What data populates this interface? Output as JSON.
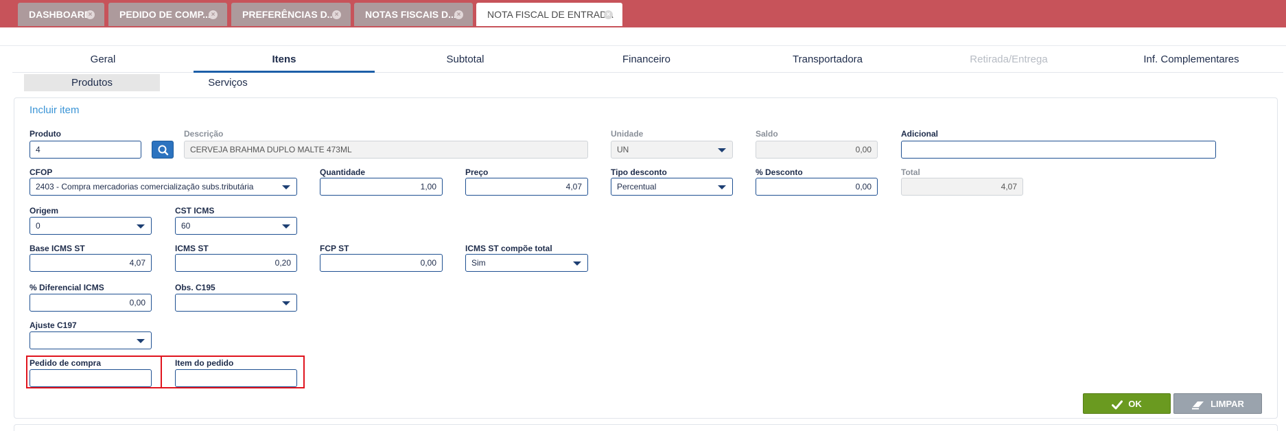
{
  "tabs": [
    {
      "label": "DASHBOARD"
    },
    {
      "label": "PEDIDO DE COMP..."
    },
    {
      "label": "PREFERÊNCIAS D..."
    },
    {
      "label": "NOTAS FISCAIS D..."
    },
    {
      "label": "NOTA FISCAL DE ENTRADA"
    }
  ],
  "nav": {
    "tabs": [
      "Geral",
      "Itens",
      "Subtotal",
      "Financeiro",
      "Transportadora",
      "Retirada/Entrega",
      "Inf. Complementares"
    ],
    "active": "Itens",
    "subtabs": [
      "Produtos",
      "Serviços"
    ]
  },
  "form": {
    "title": "Incluir item",
    "produto": {
      "label": "Produto",
      "value": "4"
    },
    "descricao": {
      "label": "Descrição",
      "value": "CERVEJA BRAHMA DUPLO MALTE 473ML"
    },
    "unidade": {
      "label": "Unidade",
      "value": "UN"
    },
    "saldo": {
      "label": "Saldo",
      "value": "0,00"
    },
    "adicional": {
      "label": "Adicional",
      "value": ""
    },
    "cfop": {
      "label": "CFOP",
      "value": "2403 - Compra mercadorias comercialização subs.tributária"
    },
    "quantidade": {
      "label": "Quantidade",
      "value": "1,00"
    },
    "preco": {
      "label": "Preço",
      "value": "4,07"
    },
    "tipo_desconto": {
      "label": "Tipo desconto",
      "value": "Percentual"
    },
    "pct_desconto": {
      "label": "% Desconto",
      "value": "0,00"
    },
    "total": {
      "label": "Total",
      "value": "4,07"
    },
    "origem": {
      "label": "Origem",
      "value": "0"
    },
    "cst_icms": {
      "label": "CST ICMS",
      "value": "60"
    },
    "base_icms_st": {
      "label": "Base ICMS ST",
      "value": "4,07"
    },
    "icms_st": {
      "label": "ICMS ST",
      "value": "0,20"
    },
    "fcp_st": {
      "label": "FCP ST",
      "value": "0,00"
    },
    "icms_st_total": {
      "label": "ICMS ST compõe total",
      "value": "Sim"
    },
    "pct_dif_icms": {
      "label": "% Diferencial ICMS",
      "value": "0,00"
    },
    "obs_c195": {
      "label": "Obs. C195",
      "value": ""
    },
    "ajuste_c197": {
      "label": "Ajuste C197",
      "value": ""
    },
    "pedido_compra": {
      "label": "Pedido de compra",
      "value": ""
    },
    "item_pedido": {
      "label": "Item do pedido",
      "value": ""
    }
  },
  "actions": {
    "ok": "OK",
    "clear": "LIMPAR"
  },
  "colors": {
    "topbar": "#c7535a",
    "accent": "#1d5fa8",
    "ok": "#6a9a20",
    "highlight": "#e0131d"
  },
  "icons": [
    "close-icon",
    "search-icon",
    "chevron-down-icon",
    "check-icon",
    "eraser-icon"
  ]
}
